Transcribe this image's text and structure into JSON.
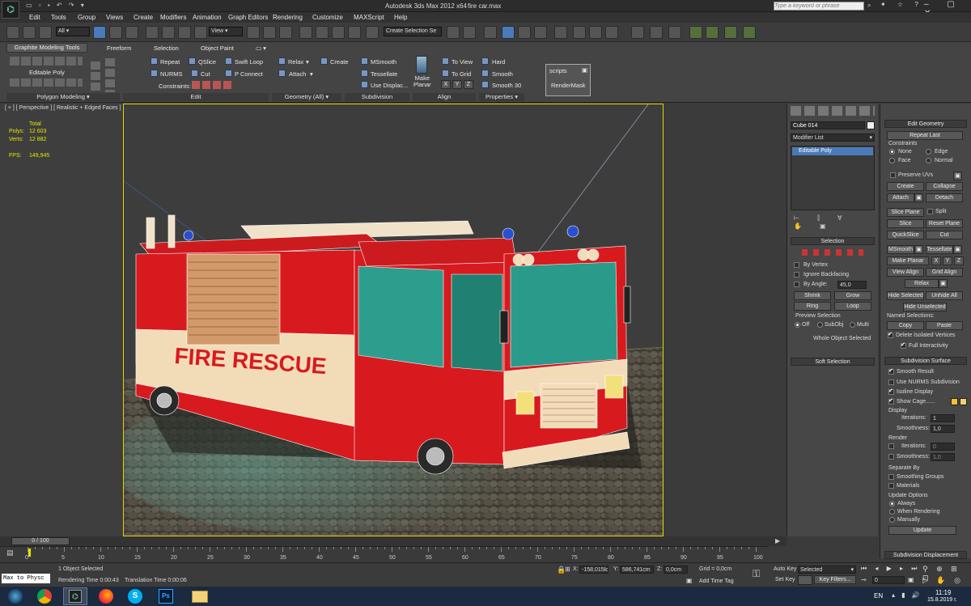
{
  "titlebar": {
    "app_title": "Autodesk 3ds Max  2012 x64",
    "file": "fire car.max",
    "search_placeholder": "Type a keyword or phrase"
  },
  "menu": [
    "Edit",
    "Tools",
    "Group",
    "Views",
    "Create",
    "Modifiers",
    "Animation",
    "Graph Editors",
    "Rendering",
    "Customize",
    "MAXScript",
    "Help"
  ],
  "toolbar": {
    "filter": "All",
    "ref_coord": "View",
    "named_sel": "Create Selection Se"
  },
  "ribbon": {
    "tabs": [
      "Graphite Modeling Tools",
      "Freeform",
      "Selection",
      "Object Paint"
    ],
    "editable_poly": "Editable Poly",
    "edit": {
      "repeat": "Repeat",
      "qslice": "QSlice",
      "swift_loop": "Swift Loop",
      "nurms": "NURMS",
      "cut": "Cut",
      "p_connect": "P Connect",
      "constraints": "Constraints:"
    },
    "geometry": {
      "relax": "Relax",
      "create": "Create",
      "attach": "Attach"
    },
    "subdivision": {
      "msmooth": "MSmooth",
      "tessellate": "Tessellate",
      "use_displace": "Use Displac..."
    },
    "make_planar": "Make\nPlanar",
    "align": {
      "to_view": "To View",
      "to_grid": "To Grid",
      "x": "X",
      "y": "Y",
      "z": "Z"
    },
    "properties": {
      "hard": "Hard",
      "smooth": "Smooth",
      "smooth30": "Smooth 30"
    },
    "sections": [
      "Polygon Modeling",
      "Edit",
      "Geometry (All)",
      "Subdivision",
      "Align",
      "Properties"
    ],
    "scripts": {
      "title": "scripts",
      "item": "RenderMask"
    }
  },
  "viewport": {
    "label": "[ + ] [ Perspective ] [ Realistic + Edged Faces ]",
    "stats": {
      "total": "Total",
      "polys_label": "Polys:",
      "polys": "12 603",
      "verts_label": "Verts:",
      "verts": "12 882",
      "fps_label": "FPS:",
      "fps": "149,945"
    },
    "truck_text": "FIRE RESCUE"
  },
  "cmd_panel": {
    "object_name": "Cube 014",
    "modifier_list": "Modifier List",
    "stack_item": "Editable Poly",
    "selection": {
      "title": "Selection",
      "by_vertex": "By Vertex",
      "ignore_backfacing": "Ignore Backfacing",
      "by_angle": "By Angle:",
      "angle": "45,0",
      "shrink": "Shrink",
      "grow": "Grow",
      "ring": "Ring",
      "loop": "Loop",
      "preview": "Preview Selection",
      "off": "Off",
      "subobj": "SubObj",
      "multi": "Multi",
      "whole": "Whole Object Selected"
    },
    "soft_selection": "Soft Selection"
  },
  "edit_geom": {
    "title": "Edit Geometry",
    "repeat_last": "Repeat Last",
    "constraints": "Constraints",
    "none": "None",
    "edge": "Edge",
    "face": "Face",
    "normal": "Normal",
    "preserve_uvs": "Preserve UVs",
    "create": "Create",
    "collapse": "Collapse",
    "attach": "Attach",
    "detach": "Detach",
    "slice_plane": "Slice Plane",
    "split": "Split",
    "slice": "Slice",
    "reset_plane": "Reset Plane",
    "quickslice": "QuickSlice",
    "cut": "Cut",
    "msmooth": "MSmooth",
    "tessellate": "Tessellate",
    "make_planar": "Make Planar",
    "x": "X",
    "y": "Y",
    "z": "Z",
    "view_align": "View Align",
    "grid_align": "Grid Align",
    "relax": "Relax",
    "hide_selected": "Hide Selected",
    "unhide_all": "Unhide All",
    "hide_unselected": "Hide Unselected",
    "named_selections": "Named Selections:",
    "copy": "Copy",
    "paste": "Paste",
    "delete_isolated": "Delete Isolated Vertices",
    "full_interactivity": "Full Interactivity"
  },
  "subdiv": {
    "title": "Subdivision Surface",
    "smooth_result": "Smooth Result",
    "use_nurms": "Use NURMS Subdivision",
    "isoline": "Isoline Display",
    "show_cage": "Show Cage......",
    "display": "Display",
    "iterations": "Iterations:",
    "iter_val": "1",
    "smoothness": "Smoothness:",
    "smooth_val": "1,0",
    "render": "Render",
    "r_iter": "0",
    "r_smooth": "1,0",
    "separate_by": "Separate By",
    "smoothing_groups": "Smoothing Groups",
    "materials": "Materials",
    "update_options": "Update Options",
    "always": "Always",
    "when_rendering": "When Rendering",
    "manually": "Manually",
    "update": "Update",
    "displacement": "Subdivision Displacement"
  },
  "timeline": {
    "frame": "0 / 100",
    "ticks": [
      "0",
      "5",
      "10",
      "15",
      "20",
      "25",
      "30",
      "35",
      "40",
      "45",
      "50",
      "55",
      "60",
      "65",
      "70",
      "75",
      "80",
      "85",
      "90",
      "95",
      "100"
    ]
  },
  "status": {
    "maxscript": "Max to Physc",
    "objects": "1 Object Selected",
    "render_time": "Rendering Time  0:00:43",
    "translation_time": "Translation Time  0:00:06",
    "x_label": "X:",
    "x": "-158,015lc",
    "y_label": "Y:",
    "y": "586,741cm",
    "z_label": "Z:",
    "z": "0,0cm",
    "grid": "Grid = 0,0cm",
    "add_time_tag": "Add Time Tag",
    "auto_key": "Auto Key",
    "selected": "Selected",
    "set_key": "Set Key",
    "key_filters": "Key Filters...",
    "frame_field": "0"
  },
  "taskbar": {
    "lang": "EN",
    "time": "11:19",
    "date": "15.8.2019 г."
  },
  "colors": {
    "accent": "#4a7ab8",
    "viewport_border": "#e5d200",
    "truck_red": "#d81a1e",
    "truck_cream": "#f2dcb8"
  }
}
